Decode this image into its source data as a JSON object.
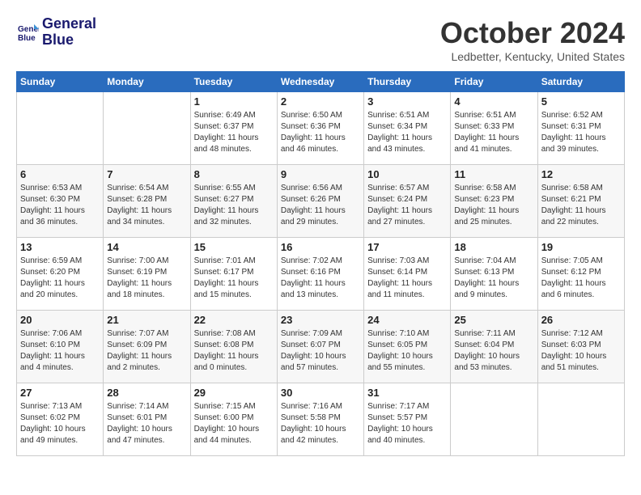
{
  "header": {
    "logo_line1": "General",
    "logo_line2": "Blue",
    "month": "October 2024",
    "location": "Ledbetter, Kentucky, United States"
  },
  "days_of_week": [
    "Sunday",
    "Monday",
    "Tuesday",
    "Wednesday",
    "Thursday",
    "Friday",
    "Saturday"
  ],
  "weeks": [
    [
      {
        "day": "",
        "info": ""
      },
      {
        "day": "",
        "info": ""
      },
      {
        "day": "1",
        "info": "Sunrise: 6:49 AM\nSunset: 6:37 PM\nDaylight: 11 hours and 48 minutes."
      },
      {
        "day": "2",
        "info": "Sunrise: 6:50 AM\nSunset: 6:36 PM\nDaylight: 11 hours and 46 minutes."
      },
      {
        "day": "3",
        "info": "Sunrise: 6:51 AM\nSunset: 6:34 PM\nDaylight: 11 hours and 43 minutes."
      },
      {
        "day": "4",
        "info": "Sunrise: 6:51 AM\nSunset: 6:33 PM\nDaylight: 11 hours and 41 minutes."
      },
      {
        "day": "5",
        "info": "Sunrise: 6:52 AM\nSunset: 6:31 PM\nDaylight: 11 hours and 39 minutes."
      }
    ],
    [
      {
        "day": "6",
        "info": "Sunrise: 6:53 AM\nSunset: 6:30 PM\nDaylight: 11 hours and 36 minutes."
      },
      {
        "day": "7",
        "info": "Sunrise: 6:54 AM\nSunset: 6:28 PM\nDaylight: 11 hours and 34 minutes."
      },
      {
        "day": "8",
        "info": "Sunrise: 6:55 AM\nSunset: 6:27 PM\nDaylight: 11 hours and 32 minutes."
      },
      {
        "day": "9",
        "info": "Sunrise: 6:56 AM\nSunset: 6:26 PM\nDaylight: 11 hours and 29 minutes."
      },
      {
        "day": "10",
        "info": "Sunrise: 6:57 AM\nSunset: 6:24 PM\nDaylight: 11 hours and 27 minutes."
      },
      {
        "day": "11",
        "info": "Sunrise: 6:58 AM\nSunset: 6:23 PM\nDaylight: 11 hours and 25 minutes."
      },
      {
        "day": "12",
        "info": "Sunrise: 6:58 AM\nSunset: 6:21 PM\nDaylight: 11 hours and 22 minutes."
      }
    ],
    [
      {
        "day": "13",
        "info": "Sunrise: 6:59 AM\nSunset: 6:20 PM\nDaylight: 11 hours and 20 minutes."
      },
      {
        "day": "14",
        "info": "Sunrise: 7:00 AM\nSunset: 6:19 PM\nDaylight: 11 hours and 18 minutes."
      },
      {
        "day": "15",
        "info": "Sunrise: 7:01 AM\nSunset: 6:17 PM\nDaylight: 11 hours and 15 minutes."
      },
      {
        "day": "16",
        "info": "Sunrise: 7:02 AM\nSunset: 6:16 PM\nDaylight: 11 hours and 13 minutes."
      },
      {
        "day": "17",
        "info": "Sunrise: 7:03 AM\nSunset: 6:14 PM\nDaylight: 11 hours and 11 minutes."
      },
      {
        "day": "18",
        "info": "Sunrise: 7:04 AM\nSunset: 6:13 PM\nDaylight: 11 hours and 9 minutes."
      },
      {
        "day": "19",
        "info": "Sunrise: 7:05 AM\nSunset: 6:12 PM\nDaylight: 11 hours and 6 minutes."
      }
    ],
    [
      {
        "day": "20",
        "info": "Sunrise: 7:06 AM\nSunset: 6:10 PM\nDaylight: 11 hours and 4 minutes."
      },
      {
        "day": "21",
        "info": "Sunrise: 7:07 AM\nSunset: 6:09 PM\nDaylight: 11 hours and 2 minutes."
      },
      {
        "day": "22",
        "info": "Sunrise: 7:08 AM\nSunset: 6:08 PM\nDaylight: 11 hours and 0 minutes."
      },
      {
        "day": "23",
        "info": "Sunrise: 7:09 AM\nSunset: 6:07 PM\nDaylight: 10 hours and 57 minutes."
      },
      {
        "day": "24",
        "info": "Sunrise: 7:10 AM\nSunset: 6:05 PM\nDaylight: 10 hours and 55 minutes."
      },
      {
        "day": "25",
        "info": "Sunrise: 7:11 AM\nSunset: 6:04 PM\nDaylight: 10 hours and 53 minutes."
      },
      {
        "day": "26",
        "info": "Sunrise: 7:12 AM\nSunset: 6:03 PM\nDaylight: 10 hours and 51 minutes."
      }
    ],
    [
      {
        "day": "27",
        "info": "Sunrise: 7:13 AM\nSunset: 6:02 PM\nDaylight: 10 hours and 49 minutes."
      },
      {
        "day": "28",
        "info": "Sunrise: 7:14 AM\nSunset: 6:01 PM\nDaylight: 10 hours and 47 minutes."
      },
      {
        "day": "29",
        "info": "Sunrise: 7:15 AM\nSunset: 6:00 PM\nDaylight: 10 hours and 44 minutes."
      },
      {
        "day": "30",
        "info": "Sunrise: 7:16 AM\nSunset: 5:58 PM\nDaylight: 10 hours and 42 minutes."
      },
      {
        "day": "31",
        "info": "Sunrise: 7:17 AM\nSunset: 5:57 PM\nDaylight: 10 hours and 40 minutes."
      },
      {
        "day": "",
        "info": ""
      },
      {
        "day": "",
        "info": ""
      }
    ]
  ]
}
